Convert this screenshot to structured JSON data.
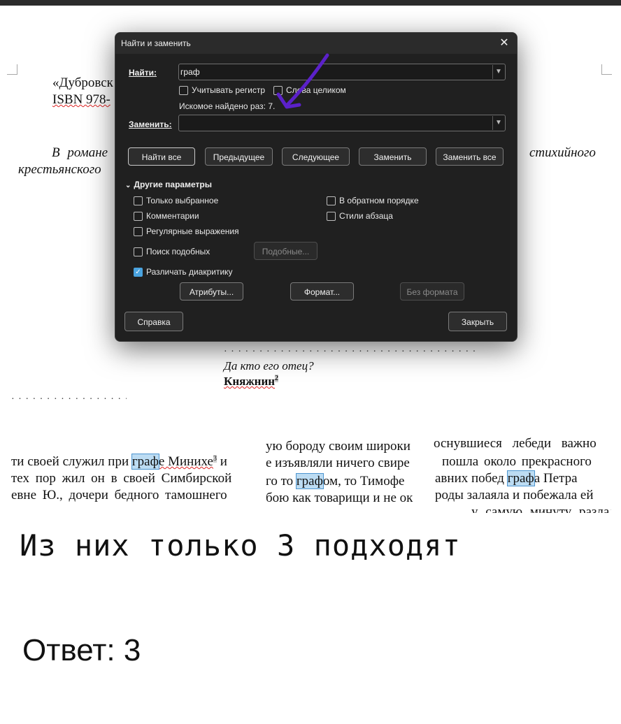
{
  "document": {
    "title_line": "«Дубровск",
    "isbn_line": "ISBN 978-",
    "para_left": "В романе",
    "para_right": "стихийного",
    "para_line2": "крестьянского",
    "dialog_line": "Да кто его отец?",
    "bold_line": "Княжнин",
    "bold_sup": "2"
  },
  "dialog": {
    "title": "Найти и заменить",
    "find_label": "Найти:",
    "find_value": "граф",
    "case_label": "Учитывать регистр",
    "whole_word_label": "Слова целиком",
    "found_text": "Искомое найдено раз: 7.",
    "replace_label": "Заменить:",
    "replace_value": "",
    "buttons": {
      "find_all": "Найти все",
      "previous": "Предыдущее",
      "next": "Следующее",
      "replace": "Заменить",
      "replace_all": "Заменить все"
    },
    "other_params": "Другие параметры",
    "options": {
      "selection_only": "Только выбранное",
      "backwards": "В обратном порядке",
      "comments": "Комментарии",
      "paragraph_styles": "Стили абзаца",
      "regex": "Регулярные выражения",
      "similarity": "Поиск подобных",
      "similar_btn": "Подобные...",
      "diacritics": "Различать диакритику"
    },
    "attributes_btn": "Атрибуты...",
    "format_btn": "Формат...",
    "no_format_btn": "Без формата",
    "help_btn": "Справка",
    "close_btn": "Закрыть",
    "accent_color": "#4aa3df",
    "arrow_color": "#5b21c9"
  },
  "strip": {
    "col1": {
      "l1_a": "ти своей служил при ",
      "l1_hl": "граф",
      "l1_b": "е Минихе",
      "l1_sup": "3",
      "l1_c": " и",
      "l2": "тех пор жил он в своей Симбирской",
      "l3": "евне Ю., дочери бедного тамошнего"
    },
    "col2": {
      "l0": "ую бороду своим широки",
      "l1": "е изъявляли ничего свире",
      "l2_a": "го то ",
      "l2_hl": "граф",
      "l2_b": "ом, то Тимофе",
      "l3": "бою как товарищи и не ок"
    },
    "col3": {
      "l0": "оснувшиеся лебеди важно",
      "l1": "пошла около прекрасного",
      "l2_a": "авних побед ",
      "l2_hl": "граф",
      "l2_b": "а Петра",
      "l3": "роды залаяла и побежала ей",
      "l4": "у самую минуту разлался"
    }
  },
  "handwritten": "Из них только 3 подходят",
  "answer": "Ответ: 3"
}
